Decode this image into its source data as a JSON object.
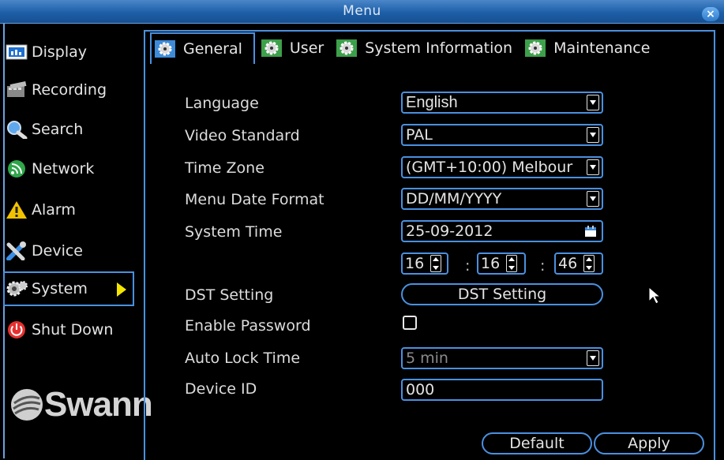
{
  "window": {
    "title": "Menu",
    "close_label": "×"
  },
  "sidebar": {
    "items": [
      {
        "label": "Display",
        "icon": "display-icon"
      },
      {
        "label": "Recording",
        "icon": "recording-icon"
      },
      {
        "label": "Search",
        "icon": "search-icon"
      },
      {
        "label": "Network",
        "icon": "network-icon"
      },
      {
        "label": "Alarm",
        "icon": "alarm-icon"
      },
      {
        "label": "Device",
        "icon": "device-icon"
      },
      {
        "label": "System",
        "icon": "gear-icon",
        "selected": true
      },
      {
        "label": "Shut Down",
        "icon": "power-icon"
      }
    ],
    "logo_text": "Swann"
  },
  "tabs": [
    {
      "label": "General",
      "active": true
    },
    {
      "label": "User"
    },
    {
      "label": "System Information"
    },
    {
      "label": "Maintenance"
    }
  ],
  "form": {
    "language": {
      "label": "Language",
      "value": "English"
    },
    "video_standard": {
      "label": "Video Standard",
      "value": "PAL"
    },
    "time_zone": {
      "label": "Time Zone",
      "value": "(GMT+10:00) Melbour"
    },
    "date_format": {
      "label": "Menu Date Format",
      "value": "DD/MM/YYYY"
    },
    "system_time": {
      "label": "System Time",
      "date": "25-09-2012",
      "hour": "16",
      "minute": "16",
      "second": "46",
      "separator": ":"
    },
    "dst": {
      "label": "DST Setting",
      "button": "DST Setting"
    },
    "enable_password": {
      "label": "Enable Password",
      "checked": false
    },
    "auto_lock": {
      "label": "Auto Lock Time",
      "value": "5 min"
    },
    "device_id": {
      "label": "Device ID",
      "value": "000"
    }
  },
  "buttons": {
    "default": "Default",
    "apply": "Apply"
  },
  "colors": {
    "accent": "#4a90e0",
    "titlebar": "#1d5fa8",
    "selected_arrow": "#f4e600"
  }
}
